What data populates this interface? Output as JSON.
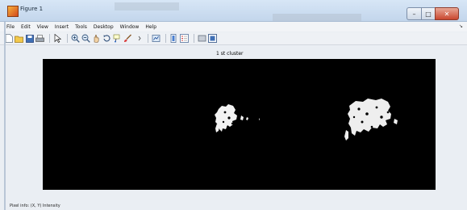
{
  "window": {
    "title": "Figure 1",
    "controls": {
      "minimize": "–",
      "maximize": "□",
      "close": "✕"
    }
  },
  "menubar": {
    "items": [
      "File",
      "Edit",
      "View",
      "Insert",
      "Tools",
      "Desktop",
      "Window",
      "Help"
    ],
    "overflow_arrow": "↘"
  },
  "toolbar": {
    "icons": [
      "new-figure-icon",
      "open-file-icon",
      "save-icon",
      "print-icon",
      "edit-plot-icon",
      "zoom-in-icon",
      "zoom-out-icon",
      "pan-icon",
      "rotate-3d-icon",
      "data-cursor-icon",
      "brush-icon",
      "link-plot-icon",
      "colorbar-icon",
      "legend-icon",
      "hide-plot-tools-icon",
      "show-plot-tools-icon"
    ]
  },
  "figure": {
    "title": "1 st cluster",
    "axes_background": "#000000"
  },
  "statusbar": {
    "text": "Pixel info: (X, Y)  Intensity"
  },
  "colors": {
    "titlebar": "#c8daee",
    "close": "#c9472f",
    "axes": "#000000"
  }
}
